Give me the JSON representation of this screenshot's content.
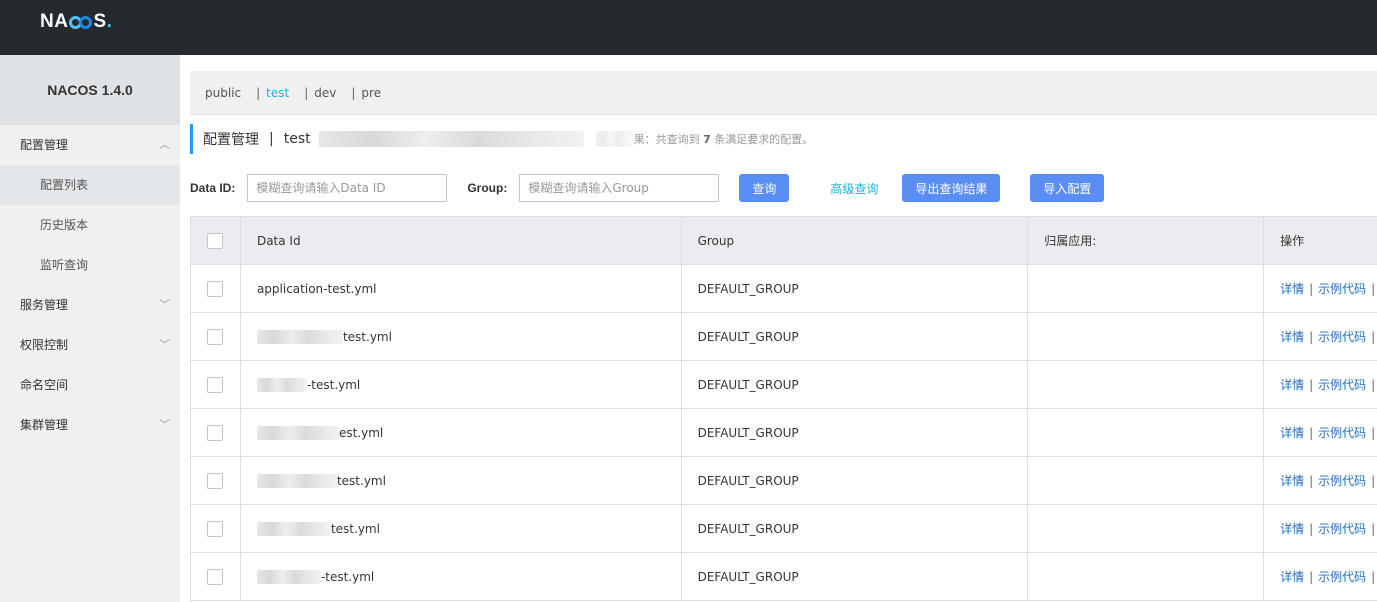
{
  "header": {
    "logo_text": "NACOS",
    "logo_dot": "."
  },
  "sidebar": {
    "version": "NACOS 1.4.0",
    "items": [
      {
        "label": "配置管理",
        "chevron": "︿",
        "sub": false
      },
      {
        "label": "配置列表",
        "sub": true,
        "active": true
      },
      {
        "label": "历史版本",
        "sub": true
      },
      {
        "label": "监听查询",
        "sub": true
      },
      {
        "label": "服务管理",
        "chevron": "﹀",
        "sub": false
      },
      {
        "label": "权限控制",
        "chevron": "﹀",
        "sub": false
      },
      {
        "label": "命名空间",
        "sub": false
      },
      {
        "label": "集群管理",
        "chevron": "﹀",
        "sub": false
      }
    ]
  },
  "namespaces": {
    "items": [
      "public",
      "test",
      "dev",
      "pre"
    ],
    "separator": "|",
    "active": "test"
  },
  "title": {
    "section": "配置管理",
    "separator": "|",
    "namespace": "test",
    "result_prefix": "果：共查询到",
    "result_count": "7",
    "result_suffix": "条满足要求的配置。"
  },
  "search": {
    "dataid_label": "Data ID:",
    "dataid_placeholder": "模糊查询请输入Data ID",
    "group_label": "Group:",
    "group_placeholder": "模糊查询请输入Group",
    "query_button": "查询",
    "advanced_link": "高级查询",
    "export_button": "导出查询结果",
    "import_button": "导入配置"
  },
  "table": {
    "headers": [
      "Data Id",
      "Group",
      "归属应用:",
      "操作"
    ],
    "rows": [
      {
        "data_id": "application-test.yml",
        "group": "DEFAULT_GROUP",
        "app": ""
      },
      {
        "data_id": "test.yml",
        "group": "DEFAULT_GROUP",
        "app": ""
      },
      {
        "data_id": "-test.yml",
        "group": "DEFAULT_GROUP",
        "app": ""
      },
      {
        "data_id": "est.yml",
        "group": "DEFAULT_GROUP",
        "app": ""
      },
      {
        "data_id": "test.yml",
        "group": "DEFAULT_GROUP",
        "app": ""
      },
      {
        "data_id": "test.yml",
        "group": "DEFAULT_GROUP",
        "app": ""
      },
      {
        "data_id": "-test.yml",
        "group": "DEFAULT_GROUP",
        "app": ""
      }
    ],
    "actions": {
      "detail": "详情",
      "sample": "示例代码",
      "separator": "|"
    }
  }
}
